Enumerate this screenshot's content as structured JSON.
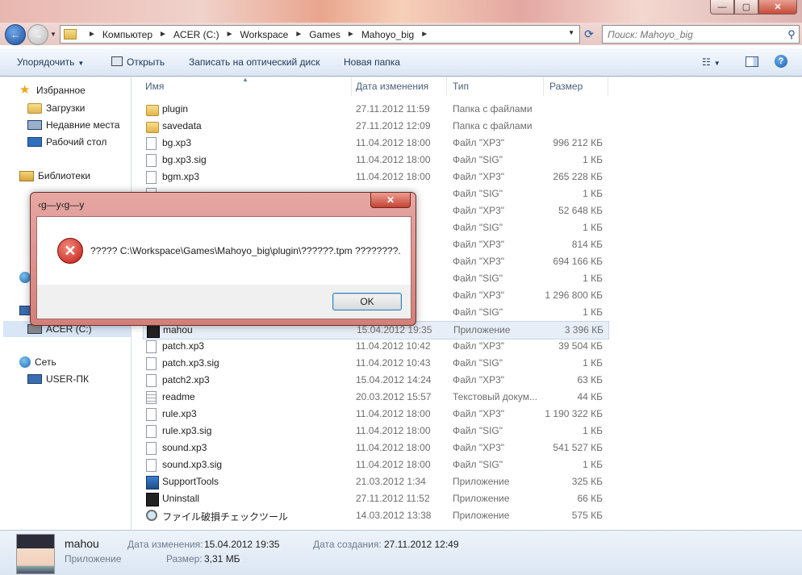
{
  "window": {
    "min": "—",
    "max": "▢",
    "close": "✕"
  },
  "nav": {
    "breadcrumbs": [
      "Компьютер",
      "ACER (C:)",
      "Workspace",
      "Games",
      "Mahoyo_big"
    ],
    "search_placeholder": "Поиск: Mahoyo_big"
  },
  "toolbar": {
    "organize": "Упорядочить",
    "open": "Открыть",
    "burn": "Записать на оптический диск",
    "new_folder": "Новая папка"
  },
  "sidebar": {
    "favorites": "Избранное",
    "downloads": "Загрузки",
    "recent": "Недавние места",
    "desktop": "Рабочий стол",
    "libraries": "Библиотеки",
    "drive": "ACER (C:)",
    "network": "Сеть",
    "user_pc": "USER-ПК"
  },
  "columns": {
    "name": "Имя",
    "date": "Дата изменения",
    "type": "Тип",
    "size": "Размер"
  },
  "files": [
    {
      "name": "plugin",
      "date": "27.11.2012 11:59",
      "type": "Папка с файлами",
      "size": "",
      "icon": "folder"
    },
    {
      "name": "savedata",
      "date": "27.11.2012 12:09",
      "type": "Папка с файлами",
      "size": "",
      "icon": "folder"
    },
    {
      "name": "bg.xp3",
      "date": "11.04.2012 18:00",
      "type": "Файл \"XP3\"",
      "size": "996 212 КБ",
      "icon": "file"
    },
    {
      "name": "bg.xp3.sig",
      "date": "11.04.2012 18:00",
      "type": "Файл \"SIG\"",
      "size": "1 КБ",
      "icon": "file"
    },
    {
      "name": "bgm.xp3",
      "date": "11.04.2012 18:00",
      "type": "Файл \"XP3\"",
      "size": "265 228 КБ",
      "icon": "file"
    },
    {
      "name": "",
      "date": "",
      "type": "Файл \"SIG\"",
      "size": "1 КБ",
      "icon": "file"
    },
    {
      "name": "",
      "date": "",
      "type": "Файл \"XP3\"",
      "size": "52 648 КБ",
      "icon": "file"
    },
    {
      "name": "",
      "date": "",
      "type": "Файл \"SIG\"",
      "size": "1 КБ",
      "icon": "file"
    },
    {
      "name": "",
      "date": "",
      "type": "Файл \"XP3\"",
      "size": "814 КБ",
      "icon": "file"
    },
    {
      "name": "",
      "date": "",
      "type": "Файл \"XP3\"",
      "size": "694 166 КБ",
      "icon": "file"
    },
    {
      "name": "",
      "date": "",
      "type": "Файл \"SIG\"",
      "size": "1 КБ",
      "icon": "file"
    },
    {
      "name": "",
      "date": "",
      "type": "Файл \"XP3\"",
      "size": "1 296 800 КБ",
      "icon": "file"
    },
    {
      "name": "",
      "date": "",
      "type": "Файл \"SIG\"",
      "size": "1 КБ",
      "icon": "file"
    },
    {
      "name": "mahou",
      "date": "15.04.2012 19:35",
      "type": "Приложение",
      "size": "3 396 КБ",
      "icon": "dark",
      "selected": true
    },
    {
      "name": "patch.xp3",
      "date": "11.04.2012 10:42",
      "type": "Файл \"XP3\"",
      "size": "39 504 КБ",
      "icon": "file"
    },
    {
      "name": "patch.xp3.sig",
      "date": "11.04.2012 10:43",
      "type": "Файл \"SIG\"",
      "size": "1 КБ",
      "icon": "file"
    },
    {
      "name": "patch2.xp3",
      "date": "15.04.2012 14:24",
      "type": "Файл \"XP3\"",
      "size": "63 КБ",
      "icon": "file"
    },
    {
      "name": "readme",
      "date": "20.03.2012 15:57",
      "type": "Текстовый докум...",
      "size": "44 КБ",
      "icon": "text"
    },
    {
      "name": "rule.xp3",
      "date": "11.04.2012 18:00",
      "type": "Файл \"XP3\"",
      "size": "1 190 322 КБ",
      "icon": "file"
    },
    {
      "name": "rule.xp3.sig",
      "date": "11.04.2012 18:00",
      "type": "Файл \"SIG\"",
      "size": "1 КБ",
      "icon": "file"
    },
    {
      "name": "sound.xp3",
      "date": "11.04.2012 18:00",
      "type": "Файл \"XP3\"",
      "size": "541 527 КБ",
      "icon": "file"
    },
    {
      "name": "sound.xp3.sig",
      "date": "11.04.2012 18:00",
      "type": "Файл \"SIG\"",
      "size": "1 КБ",
      "icon": "file"
    },
    {
      "name": "SupportTools",
      "date": "21.03.2012 1:34",
      "type": "Приложение",
      "size": "325 КБ",
      "icon": "app"
    },
    {
      "name": "Uninstall",
      "date": "27.11.2012 11:52",
      "type": "Приложение",
      "size": "66 КБ",
      "icon": "dark"
    },
    {
      "name": "ファイル破損チェックツール",
      "date": "14.03.2012 13:38",
      "type": "Приложение",
      "size": "575 КБ",
      "icon": "magnifier"
    }
  ],
  "status": {
    "name": "mahou",
    "type": "Приложение",
    "modified_label": "Дата изменения:",
    "modified": "15.04.2012 19:35",
    "created_label": "Дата создания:",
    "created": "27.11.2012 12:49",
    "size_label": "Размер:",
    "size": "3,31 МБ"
  },
  "dialog": {
    "title": "‹g—у‹g—у",
    "message": "????? C:\\Workspace\\Games\\Mahoyo_big\\plugin\\??????.tpm ????????.",
    "ok": "OK",
    "close": "✕"
  }
}
